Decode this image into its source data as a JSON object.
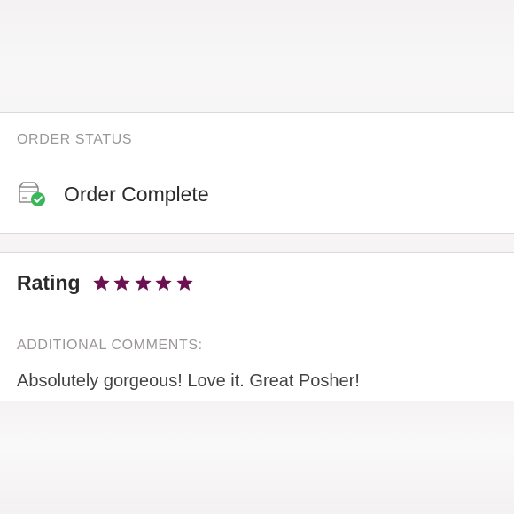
{
  "order_status": {
    "section_label": "ORDER STATUS",
    "status_text": "Order Complete",
    "status_icon": "box-check-icon"
  },
  "review": {
    "rating_label": "Rating",
    "rating_value": 5,
    "rating_max": 5,
    "star_color": "#6b1150",
    "comments_label": "ADDITIONAL COMMENTS:",
    "comment_text": "Absolutely gorgeous! Love it. Great Posher!"
  },
  "colors": {
    "success_green": "#3cb65a",
    "star_plum": "#6b1150"
  }
}
